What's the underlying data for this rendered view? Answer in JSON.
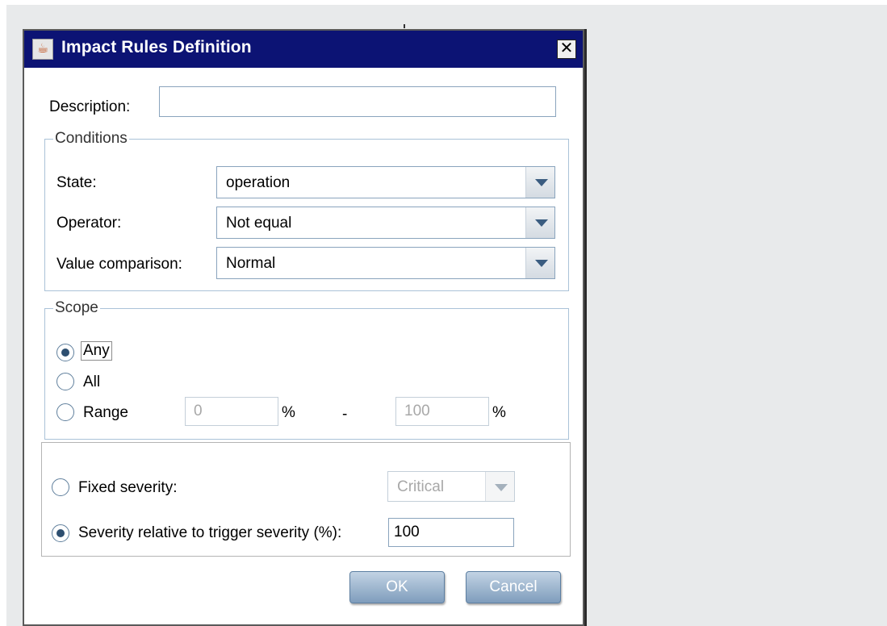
{
  "window": {
    "title": "Impact Rules Definition",
    "close_glyph": "✕",
    "app_icon": "java-icon"
  },
  "description": {
    "label": "Description:",
    "value": ""
  },
  "conditions": {
    "title": "Conditions",
    "state": {
      "label": "State:",
      "value": "operation"
    },
    "operator": {
      "label": "Operator:",
      "value": "Not equal"
    },
    "value_comparison": {
      "label": "Value comparison:",
      "value": "Normal"
    }
  },
  "scope": {
    "title": "Scope",
    "options": [
      {
        "label": "Any",
        "checked": true
      },
      {
        "label": "All",
        "checked": false
      },
      {
        "label": "Range",
        "checked": false
      }
    ],
    "range_from": "0",
    "range_to": "100",
    "percent_symbol": "%",
    "dash": "-"
  },
  "severity": {
    "fixed_label": "Fixed severity:",
    "fixed_checked": false,
    "fixed_value": "Critical",
    "relative_label": "Severity relative to trigger severity (%):",
    "relative_checked": true,
    "relative_value": "100"
  },
  "buttons": {
    "ok": "OK",
    "cancel": "Cancel"
  }
}
